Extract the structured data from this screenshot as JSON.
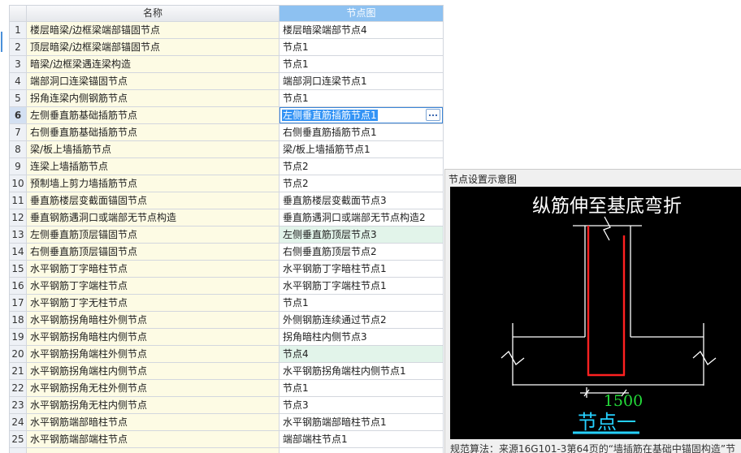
{
  "table": {
    "headers": {
      "name": "名称",
      "node": "节点图"
    },
    "rows": [
      {
        "no": "1",
        "name": "楼层暗梁/边框梁端部锚固节点",
        "node": "楼层暗梁端部节点4"
      },
      {
        "no": "2",
        "name": "顶层暗梁/边框梁端部锚固节点",
        "node": "节点1"
      },
      {
        "no": "3",
        "name": "暗梁/边框梁遇连梁构造",
        "node": "节点1"
      },
      {
        "no": "4",
        "name": "端部洞口连梁锚固节点",
        "node": "端部洞口连梁节点1"
      },
      {
        "no": "5",
        "name": "拐角连梁内侧钢筋节点",
        "node": "节点1"
      },
      {
        "no": "6",
        "name": "左侧垂直筋基础插筋节点",
        "node": "左侧垂直筋插筋节点1",
        "selected": true,
        "editing": true
      },
      {
        "no": "7",
        "name": "右侧垂直筋基础插筋节点",
        "node": "右侧垂直筋插筋节点1"
      },
      {
        "no": "8",
        "name": "梁/板上墙插筋节点",
        "node": "梁/板上墙插筋节点1"
      },
      {
        "no": "9",
        "name": "连梁上墙插筋节点",
        "node": "节点2"
      },
      {
        "no": "10",
        "name": "预制墙上剪力墙插筋节点",
        "node": "节点2"
      },
      {
        "no": "11",
        "name": "垂直筋楼层变截面锚固节点",
        "node": "垂直筋楼层变截面节点3"
      },
      {
        "no": "12",
        "name": "垂直钢筋遇洞口或端部无节点构造",
        "node": "垂直筋遇洞口或端部无节点构造2"
      },
      {
        "no": "13",
        "name": "左侧垂直筋顶层锚固节点",
        "node": "左侧垂直筋顶层节点3",
        "highlighted": true
      },
      {
        "no": "14",
        "name": "右侧垂直筋顶层锚固节点",
        "node": "右侧垂直筋顶层节点2"
      },
      {
        "no": "15",
        "name": "水平钢筋丁字暗柱节点",
        "node": "水平钢筋丁字暗柱节点1"
      },
      {
        "no": "16",
        "name": "水平钢筋丁字端柱节点",
        "node": "水平钢筋丁字端柱节点1"
      },
      {
        "no": "17",
        "name": "水平钢筋丁字无柱节点",
        "node": "节点1"
      },
      {
        "no": "18",
        "name": "水平钢筋拐角暗柱外侧节点",
        "node": "外侧钢筋连续通过节点2"
      },
      {
        "no": "19",
        "name": "水平钢筋拐角暗柱内侧节点",
        "node": "拐角暗柱内侧节点3"
      },
      {
        "no": "20",
        "name": "水平钢筋拐角端柱外侧节点",
        "node": "节点4",
        "highlighted": true
      },
      {
        "no": "21",
        "name": "水平钢筋拐角端柱内侧节点",
        "node": "水平钢筋拐角端柱内侧节点1"
      },
      {
        "no": "22",
        "name": "水平钢筋拐角无柱外侧节点",
        "node": "节点1"
      },
      {
        "no": "23",
        "name": "水平钢筋拐角无柱内侧节点",
        "node": "节点3"
      },
      {
        "no": "24",
        "name": "水平钢筋端部暗柱节点",
        "node": "水平钢筋端部暗柱节点1"
      },
      {
        "no": "25",
        "name": "水平钢筋端部端柱节点",
        "node": "端部端柱节点1"
      }
    ],
    "browse_icon": "ellipsis-icon"
  },
  "panel": {
    "title": "节点设置示意图",
    "diagram": {
      "heading": "纵筋伸至基底弯折",
      "dimension": "1500",
      "caption": "节点一"
    },
    "footer": "规范算法：来源16G101-3第64页的“墙插筋在基础中锚固构造”节"
  },
  "colors": {
    "header_accent": "#8dc1f1",
    "name_cell": "#fdfbe4",
    "highlight_cell": "#e2f4ea",
    "selection": "#3393f5",
    "diagram_bg": "#000000",
    "diagram_line": "#ffffff",
    "rebar": "#ff2121",
    "dimension_text": "#24dc3a",
    "caption_text": "#25d0ff"
  }
}
